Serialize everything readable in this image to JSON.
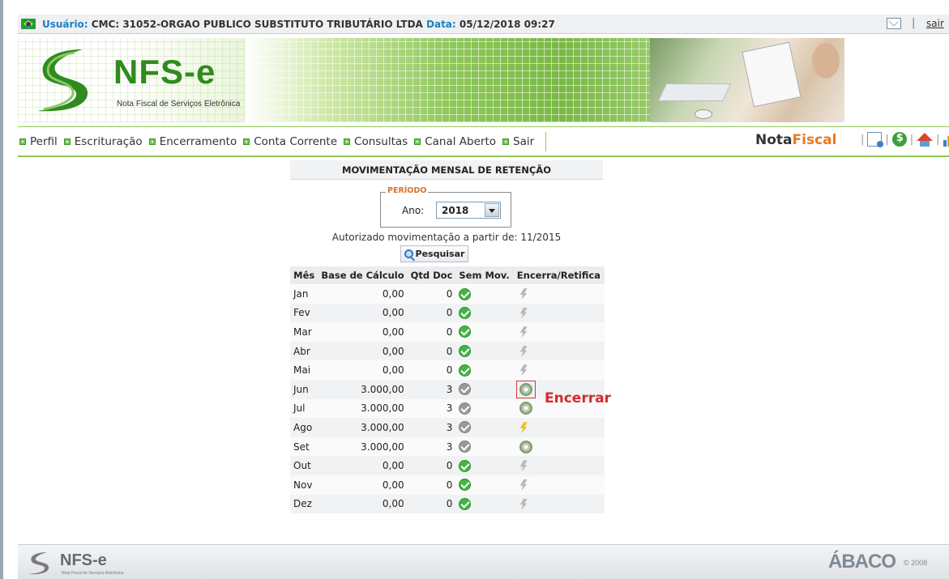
{
  "topbar": {
    "usuario_key": "Usuário:",
    "usuario_val": "CMC: 31052-ORGAO PUBLICO SUBSTITUTO TRIBUTÁRIO LTDA",
    "data_key": "Data:",
    "data_val": "05/12/2018 09:27",
    "separator": "|",
    "sair": "sair"
  },
  "banner": {
    "logo": "NFS-e",
    "subtitle": "Nota Fiscal de Serviços Eletrônica"
  },
  "nav": {
    "items": [
      "Perfil",
      "Escrituração",
      "Encerramento",
      "Conta Corrente",
      "Consultas",
      "Canal Aberto",
      "Sair"
    ],
    "brand_a": "Nota",
    "brand_b": "Fiscal",
    "icon_sep": "|"
  },
  "main": {
    "title": "MOVIMENTAÇÃO MENSAL DE RETENÇÃO",
    "periodo_legend": "PERÍODO",
    "ano_label": "Ano:",
    "ano_value": "2018",
    "autorizado": "Autorizado movimentação a partir de: 11/2015",
    "pesquisar": "Pesquisar",
    "headers": [
      "Mês",
      "Base de Cálculo",
      "Qtd Doc",
      "Sem Mov.",
      "Encerra/Retifica"
    ],
    "rows": [
      {
        "mes": "Jan",
        "base": "0,00",
        "qtd": "0",
        "sem_mov": "check-green",
        "action": "bolt-gray"
      },
      {
        "mes": "Fev",
        "base": "0,00",
        "qtd": "0",
        "sem_mov": "check-green",
        "action": "bolt-gray"
      },
      {
        "mes": "Mar",
        "base": "0,00",
        "qtd": "0",
        "sem_mov": "check-green",
        "action": "bolt-gray"
      },
      {
        "mes": "Abr",
        "base": "0,00",
        "qtd": "0",
        "sem_mov": "check-green",
        "action": "bolt-gray"
      },
      {
        "mes": "Mai",
        "base": "0,00",
        "qtd": "0",
        "sem_mov": "check-green",
        "action": "bolt-gray"
      },
      {
        "mes": "Jun",
        "base": "3.000,00",
        "qtd": "3",
        "sem_mov": "check-gray",
        "action": "gear-highlighted"
      },
      {
        "mes": "Jul",
        "base": "3.000,00",
        "qtd": "3",
        "sem_mov": "check-gray",
        "action": "gear"
      },
      {
        "mes": "Ago",
        "base": "3.000,00",
        "qtd": "3",
        "sem_mov": "check-gray",
        "action": "bolt-yellow"
      },
      {
        "mes": "Set",
        "base": "3.000,00",
        "qtd": "3",
        "sem_mov": "check-gray",
        "action": "gear"
      },
      {
        "mes": "Out",
        "base": "0,00",
        "qtd": "0",
        "sem_mov": "check-green",
        "action": "bolt-gray"
      },
      {
        "mes": "Nov",
        "base": "0,00",
        "qtd": "0",
        "sem_mov": "check-green",
        "action": "bolt-gray"
      },
      {
        "mes": "Dez",
        "base": "0,00",
        "qtd": "0",
        "sem_mov": "check-green",
        "action": "bolt-gray"
      }
    ],
    "encerrar_annotation": "Encerrar"
  },
  "footer": {
    "logo": "NFS-e",
    "subtitle": "Nota Fiscal de Serviços Eletrônica",
    "abaco": "ÁBACO",
    "copyright": "© 2008"
  },
  "colors": {
    "accent_blue": "#1e7fc3",
    "brand_green": "#2f8b1e",
    "nav_border": "#8fc85a",
    "brand_orange": "#e87a1e",
    "alert_red": "#d42a2a"
  }
}
